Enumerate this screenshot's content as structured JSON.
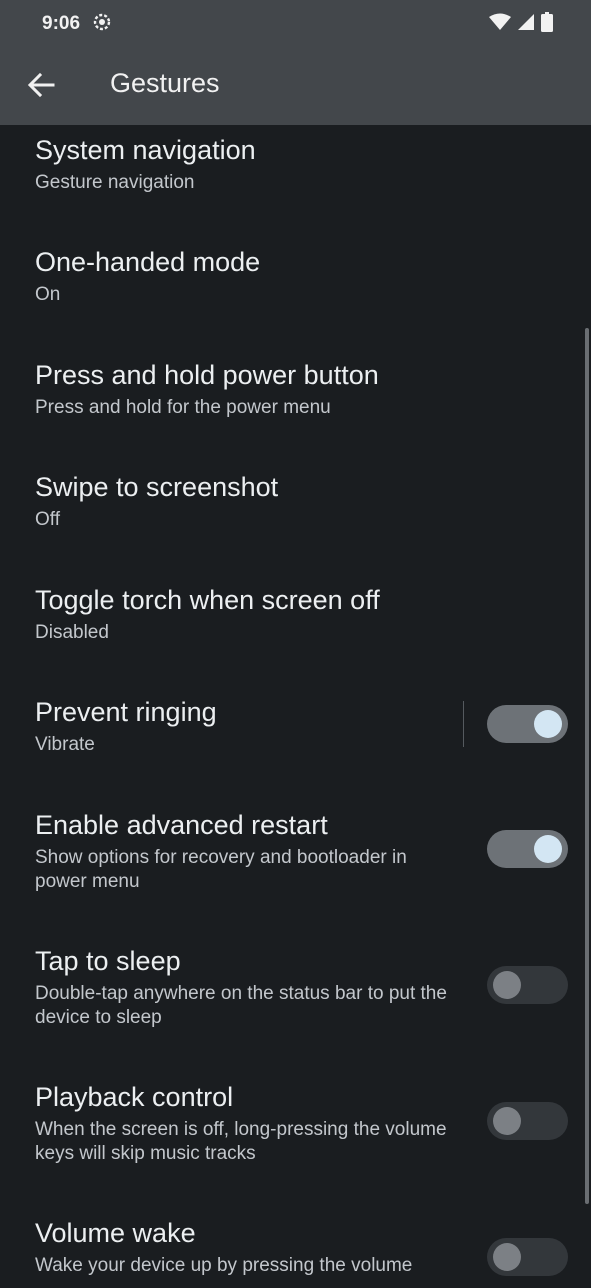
{
  "status": {
    "time": "9:06"
  },
  "header": {
    "title": "Gestures"
  },
  "items": [
    {
      "title": "System navigation",
      "summary": "Gesture navigation"
    },
    {
      "title": "One-handed mode",
      "summary": "On"
    },
    {
      "title": "Press and hold power button",
      "summary": "Press and hold for the power menu"
    },
    {
      "title": "Swipe to screenshot",
      "summary": "Off"
    },
    {
      "title": "Toggle torch when screen off",
      "summary": "Disabled"
    },
    {
      "title": "Prevent ringing",
      "summary": "Vibrate",
      "switch": "on"
    },
    {
      "title": "Enable advanced restart",
      "summary": "Show options for recovery and bootloader in power menu",
      "switch": "on"
    },
    {
      "title": "Tap to sleep",
      "summary": "Double-tap anywhere on the status bar to put the device to sleep",
      "switch": "off"
    },
    {
      "title": "Playback control",
      "summary": "When the screen is off, long-pressing the volume keys will skip music tracks",
      "switch": "off"
    },
    {
      "title": "Volume wake",
      "summary": "Wake your device up by pressing the volume",
      "switch": "off"
    }
  ],
  "colors": {
    "background": "#1a1d20",
    "app_bar": "#43474b",
    "switch_on_thumb": "#d3e6f3"
  }
}
